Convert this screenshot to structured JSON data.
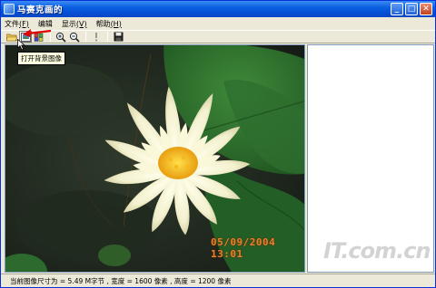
{
  "window": {
    "title": "马赛克画的",
    "controls": {
      "minimize": "_",
      "maximize": "□",
      "close": "✕"
    }
  },
  "menu": {
    "items": [
      {
        "label": "文件",
        "key": "(F)"
      },
      {
        "label": "编辑",
        "key": ""
      },
      {
        "label": "显示",
        "key": "(V)"
      },
      {
        "label": "帮助",
        "key": "(H)"
      }
    ]
  },
  "toolbar": {
    "buttons": [
      "open-folder-icon",
      "open-background-image-icon",
      "load-tiles-icon",
      "zoom-in-icon",
      "zoom-out-icon",
      "info-icon",
      "save-icon"
    ]
  },
  "tooltip": {
    "text": "打开背景图像"
  },
  "photo": {
    "date_stamp": "05/09/2004 13:01",
    "watermark": "IT.com.cn"
  },
  "status": {
    "text": "当前图像尺寸为 = 5.49 M字节 , 宽度 = 1600 像素 , 高度 = 1200 像素"
  },
  "colors": {
    "accent": "#0a5fe0",
    "arrow": "#e00000"
  }
}
